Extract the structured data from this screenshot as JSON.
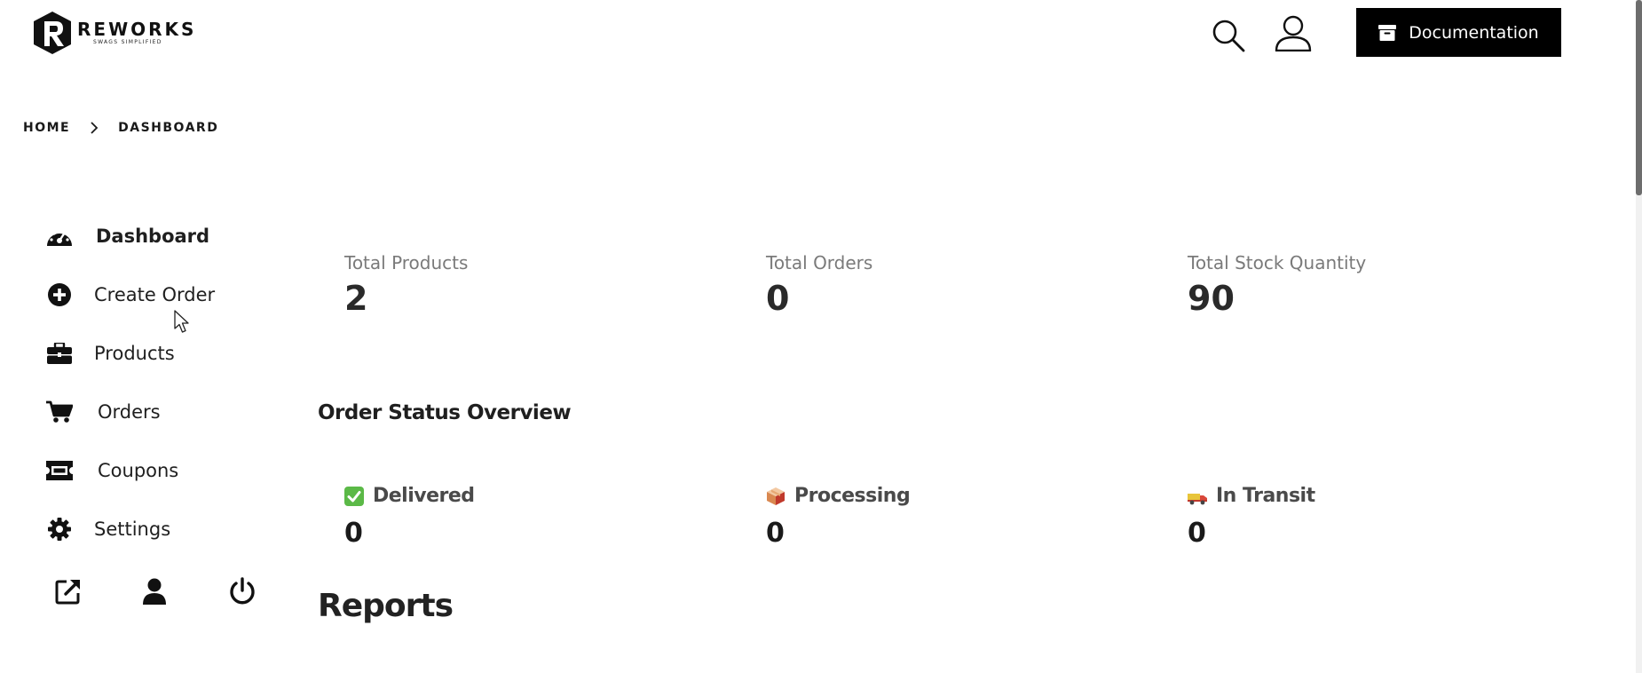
{
  "header": {
    "logo_name": "REWORKS",
    "logo_tagline": "SWAGS SIMPLIFIED",
    "documentation_label": "Documentation"
  },
  "breadcrumb": {
    "home": "HOME",
    "current": "DASHBOARD"
  },
  "sidebar": {
    "items": [
      {
        "label": "Dashboard",
        "icon": "speedometer-icon",
        "active": true
      },
      {
        "label": "Create Order",
        "icon": "plus-circle-icon",
        "active": false
      },
      {
        "label": "Products",
        "icon": "briefcase-icon",
        "active": false
      },
      {
        "label": "Orders",
        "icon": "cart-icon",
        "active": false
      },
      {
        "label": "Coupons",
        "icon": "ticket-icon",
        "active": false
      },
      {
        "label": "Settings",
        "icon": "gear-icon",
        "active": false
      }
    ],
    "bottom_icons": [
      "external-link-icon",
      "user-icon",
      "power-icon"
    ]
  },
  "stats": [
    {
      "label": "Total Products",
      "value": "2"
    },
    {
      "label": "Total Orders",
      "value": "0"
    },
    {
      "label": "Total Stock Quantity",
      "value": "90"
    }
  ],
  "order_status": {
    "title": "Order Status Overview",
    "items": [
      {
        "label": "Delivered",
        "value": "0",
        "icon": "check-box-icon"
      },
      {
        "label": "Processing",
        "value": "0",
        "icon": "package-icon"
      },
      {
        "label": "In Transit",
        "value": "0",
        "icon": "truck-icon"
      }
    ]
  },
  "reports": {
    "title": "Reports"
  },
  "colors": {
    "primary": "#000000",
    "text": "#1f1f1f",
    "muted": "#7a7a7a",
    "delivered_green": "#5bb947",
    "package_red": "#c0392b",
    "truck_yellow": "#e8c53a"
  }
}
